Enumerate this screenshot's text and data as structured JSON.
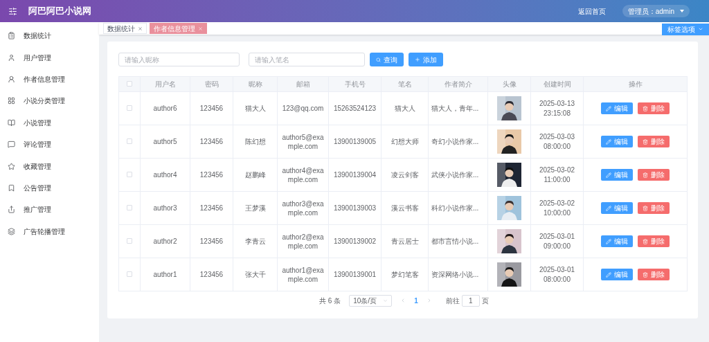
{
  "header": {
    "title": "阿巴阿巴小说网",
    "home_link": "返回首页",
    "user_menu": "管理员：admin"
  },
  "sidebar": {
    "items": [
      {
        "label": "数据统计"
      },
      {
        "label": "用户管理"
      },
      {
        "label": "作者信息管理"
      },
      {
        "label": "小说分类管理"
      },
      {
        "label": "小说管理"
      },
      {
        "label": "评论管理"
      },
      {
        "label": "收藏管理"
      },
      {
        "label": "公告管理"
      },
      {
        "label": "推广管理"
      },
      {
        "label": "广告轮播管理"
      }
    ]
  },
  "tags": [
    {
      "label": "数据统计",
      "selected": false
    },
    {
      "label": "作者信息管理",
      "selected": true
    }
  ],
  "tag_options": "标签选项",
  "search": {
    "nickname_placeholder": "请输入昵称",
    "penname_placeholder": "请输入笔名",
    "query_button": "查询",
    "add_button": "添加"
  },
  "table": {
    "columns": [
      "用户名",
      "密码",
      "昵称",
      "邮箱",
      "手机号",
      "笔名",
      "作者简介",
      "头像",
      "创建时间",
      "操作"
    ],
    "all_checked": false,
    "rows": [
      {
        "checked": false,
        "cells": [
          "author6",
          "123456",
          "猫大人",
          "123@qq.com",
          "15263524123",
          "猫大人",
          "猫大人，青年...",
          "2025-03-13 23:15:08"
        ],
        "edit_label": "编辑",
        "delete_label": "删除"
      },
      {
        "checked": false,
        "cells": [
          "author5",
          "123456",
          "陈幻想",
          "author5@example.com",
          "13900139005",
          "幻想大师",
          "奇幻小说作家...",
          "2025-03-03 08:00:00"
        ],
        "edit_label": "编辑",
        "delete_label": "删除"
      },
      {
        "checked": false,
        "cells": [
          "author4",
          "123456",
          "赵鹏峰",
          "author4@example.com",
          "13900139004",
          "凌云剑客",
          "武侠小说作家...",
          "2025-03-02 11:00:00"
        ],
        "edit_label": "编辑",
        "delete_label": "删除"
      },
      {
        "checked": false,
        "cells": [
          "author3",
          "123456",
          "王梦溪",
          "author3@example.com",
          "13900139003",
          "溪云书客",
          "科幻小说作家...",
          "2025-03-02 10:00:00"
        ],
        "edit_label": "编辑",
        "delete_label": "删除"
      },
      {
        "checked": false,
        "cells": [
          "author2",
          "123456",
          "李青云",
          "author2@example.com",
          "13900139002",
          "青云居士",
          "都市言情小说...",
          "2025-03-01 09:00:00"
        ],
        "edit_label": "编辑",
        "delete_label": "删除"
      },
      {
        "checked": false,
        "cells": [
          "author1",
          "123456",
          "张大千",
          "author1@example.com",
          "13900139001",
          "梦幻笔客",
          "资深网络小说...",
          "2025-03-01 08:00:00"
        ],
        "edit_label": "编辑",
        "delete_label": "删除"
      }
    ]
  },
  "pagination": {
    "total": "共 6 条",
    "page_size": "10条/页",
    "pages": [
      {
        "label": "1",
        "selected": true
      }
    ],
    "goto_label": "前往",
    "goto_value": "1",
    "page_suffix": "页"
  }
}
